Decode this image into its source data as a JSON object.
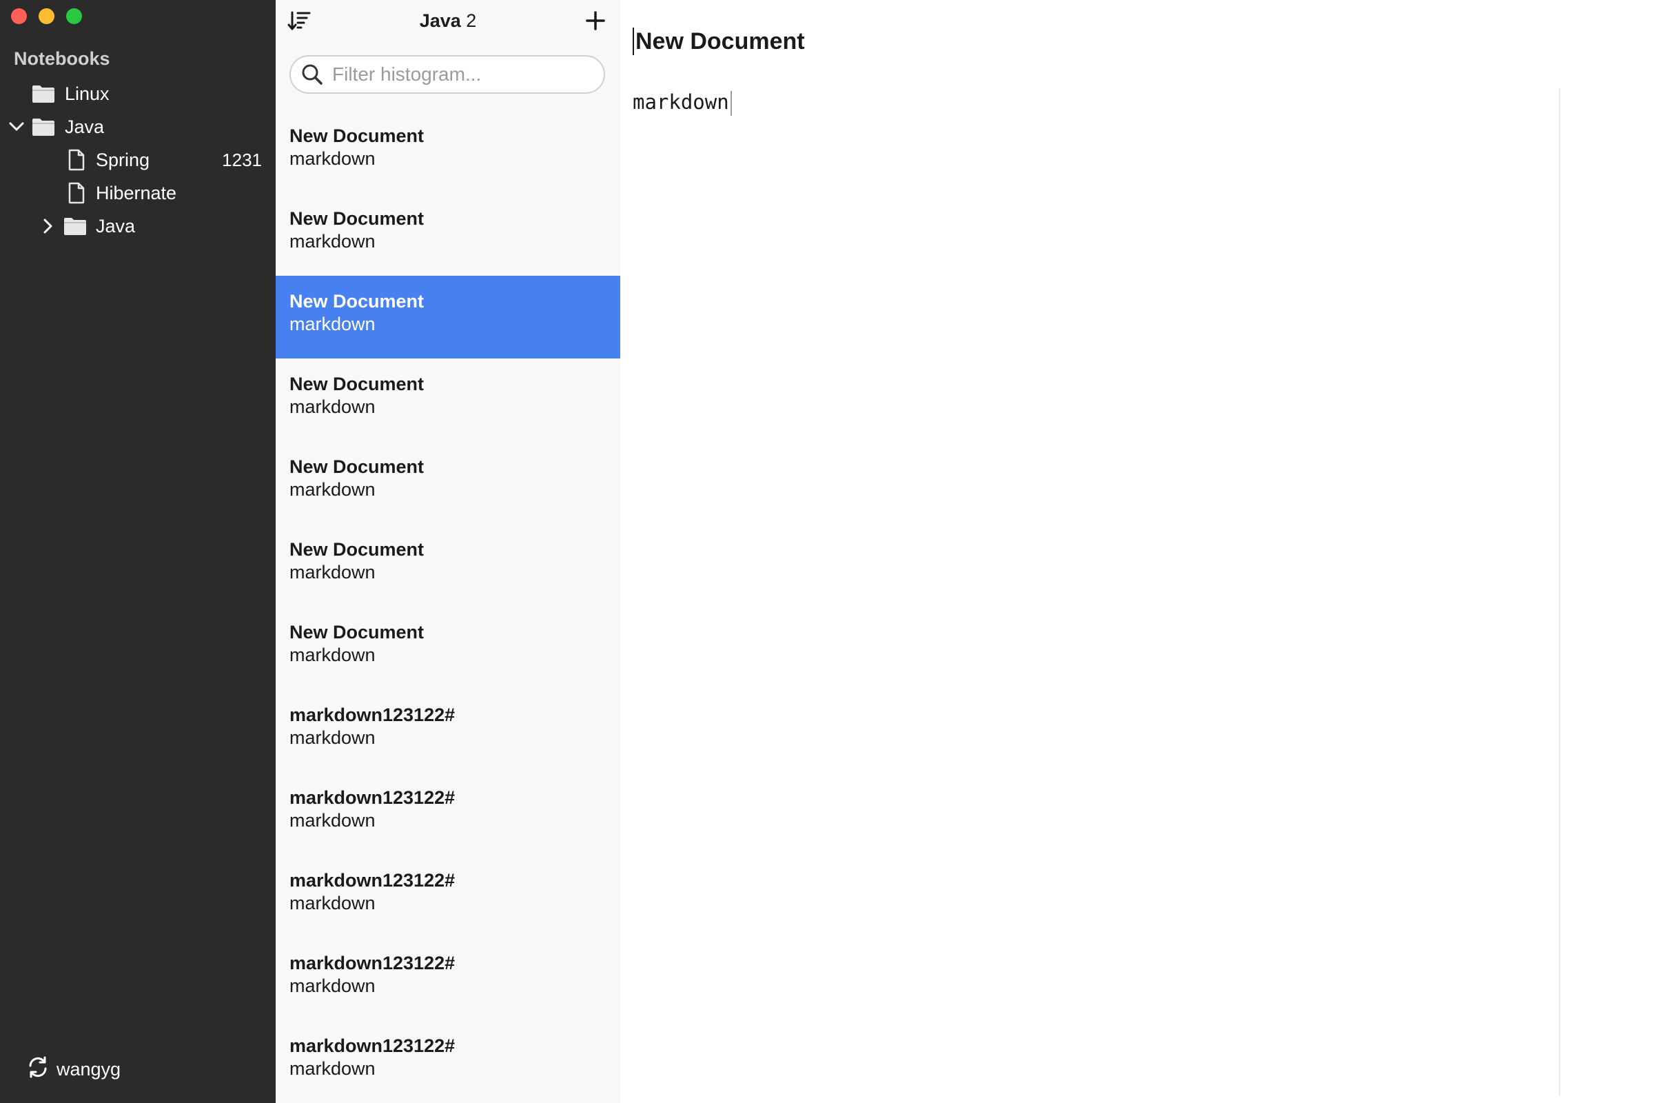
{
  "sidebar": {
    "header": "Notebooks",
    "tree": {
      "linux": {
        "label": "Linux"
      },
      "java": {
        "label": "Java"
      },
      "spring": {
        "label": "Spring",
        "count": "1231"
      },
      "hibernate": {
        "label": "Hibernate"
      },
      "java_sub": {
        "label": "Java"
      }
    },
    "footer": {
      "user": "wangyg",
      "icon": "sync-icon"
    }
  },
  "notelist": {
    "title_name": "Java",
    "title_count": "2",
    "search_placeholder": "Filter histogram...",
    "notes": [
      {
        "title": "New Document",
        "sub": "markdown"
      },
      {
        "title": "New Document",
        "sub": "markdown"
      },
      {
        "title": "New Document",
        "sub": "markdown"
      },
      {
        "title": "New Document",
        "sub": "markdown"
      },
      {
        "title": "New Document",
        "sub": "markdown"
      },
      {
        "title": "New Document",
        "sub": "markdown"
      },
      {
        "title": "New Document",
        "sub": "markdown"
      },
      {
        "title": "markdown123122#",
        "sub": "markdown"
      },
      {
        "title": "markdown123122#",
        "sub": "markdown"
      },
      {
        "title": "markdown123122#",
        "sub": "markdown"
      },
      {
        "title": "markdown123122#",
        "sub": "markdown"
      },
      {
        "title": "markdown123122#",
        "sub": "markdown"
      }
    ],
    "selected_index": 2
  },
  "editor": {
    "title": "New Document",
    "body": "markdown"
  },
  "colors": {
    "sidebar_bg": "#2b2b2b",
    "selection": "#4781f1",
    "close": "#fe5f57",
    "minimize": "#febc2e",
    "maximize": "#28c840"
  }
}
